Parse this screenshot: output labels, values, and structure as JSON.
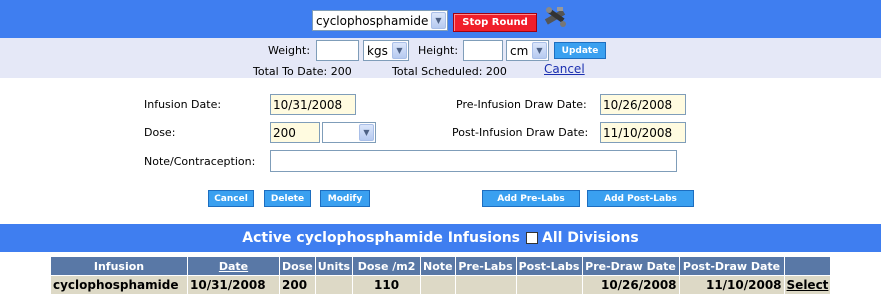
{
  "drug_select": {
    "value": "cyclophosphamide"
  },
  "stop_round_label": "Stop Round",
  "measure": {
    "weight_label": "Weight:",
    "weight_value": "",
    "weight_unit": "kgs",
    "height_label": "Height:",
    "height_value": "",
    "height_unit": "cm",
    "update_label": "Update"
  },
  "totals": {
    "to_date": "Total To Date: 200",
    "scheduled": "Total Scheduled: 200",
    "cancel_link": "Cancel"
  },
  "form": {
    "infusion_date_label": "Infusion Date:",
    "infusion_date_value": "10/31/2008",
    "dose_label": "Dose:",
    "dose_value": "200",
    "dose_unit": "",
    "note_label": "Note/Contraception:",
    "note_value": "",
    "pre_draw_label": "Pre-Infusion Draw Date:",
    "pre_draw_value": "10/26/2008",
    "post_draw_label": "Post-Infusion Draw Date:",
    "post_draw_value": "11/10/2008"
  },
  "actions": {
    "cancel": "Cancel",
    "delete": "Delete",
    "modify": "Modify",
    "add_pre_labs": "Add Pre-Labs",
    "add_post_labs": "Add Post-Labs"
  },
  "active": {
    "title": "Active cyclophosphamide Infusions",
    "all_divisions": "All Divisions"
  },
  "table": {
    "headers": [
      "Infusion",
      "Date",
      "Dose",
      "Units",
      "Dose /m2",
      "Note",
      "Pre-Labs",
      "Post-Labs",
      "Pre-Draw Date",
      "Post-Draw Date",
      ""
    ],
    "rows": [
      {
        "infusion": "cyclophosphamide",
        "date": "10/31/2008",
        "dose": "200",
        "units": "",
        "dose_m2": "110",
        "note": "",
        "pre_labs": "",
        "post_labs": "",
        "pre_draw": "10/26/2008",
        "post_draw": "11/10/2008",
        "action": "Select"
      }
    ]
  },
  "colors": {
    "header_blue": "#3f7ef0",
    "band": "#e5e8f7",
    "stop_red": "#f01e2a",
    "button_blue": "#3aa0f0",
    "table_header": "#5978a6",
    "table_row": "#ddd9c6",
    "input_yellow": "#fffbe0"
  }
}
